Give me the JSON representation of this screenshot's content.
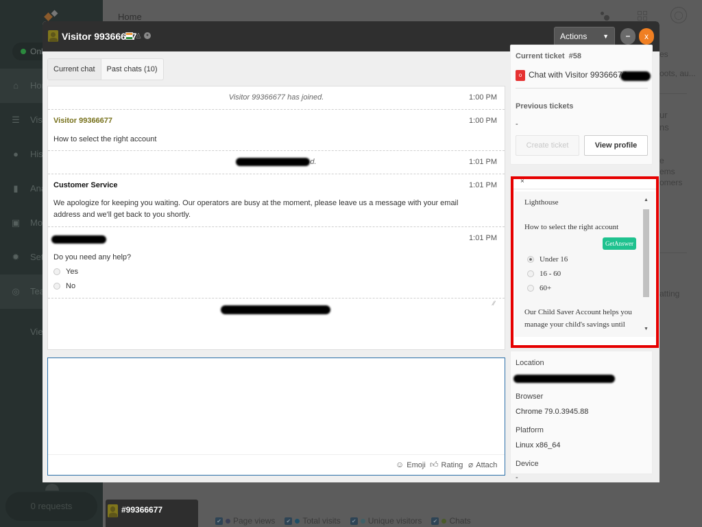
{
  "background": {
    "sidebar": {
      "status_label": "Online",
      "items": [
        {
          "label": "Home",
          "icon": "home-icon"
        },
        {
          "label": "Visitors",
          "icon": "visitors-icon"
        },
        {
          "label": "History",
          "icon": "clock-icon"
        },
        {
          "label": "Analytics",
          "icon": "bar-chart-icon"
        },
        {
          "label": "Monitor",
          "icon": "monitor-icon"
        },
        {
          "label": "Settings",
          "icon": "gear-icon"
        },
        {
          "label": "Teams",
          "icon": "teams-icon"
        }
      ],
      "view_label": "View",
      "requests_label": "0 requests"
    },
    "topbar": {
      "breadcrumb": "Home"
    },
    "right_text": [
      "es",
      "oots, au...",
      "ur",
      "ns",
      "e",
      "ems",
      "omers",
      "atting"
    ],
    "legend": [
      {
        "label": "Page views",
        "color": "#3a3f55"
      },
      {
        "label": "Total visits",
        "color": "#1f4f66"
      },
      {
        "label": "Unique visitors",
        "color": "#3f5f66"
      },
      {
        "label": "Chats",
        "color": "#4a5a2a"
      }
    ],
    "minichat_label": "#99366677"
  },
  "modal": {
    "title": "Visitor 99366677",
    "actions_label": "Actions",
    "minimize_label": "–",
    "close_label": "x",
    "tabs": [
      {
        "label": "Current chat",
        "active": true
      },
      {
        "label": "Past chats (10)",
        "active": false
      }
    ],
    "messages": [
      {
        "type": "system",
        "text": "Visitor 99366677 has joined.",
        "time": "1:00 PM"
      },
      {
        "type": "visitor",
        "author": "Visitor 99366677",
        "text": "How to select the right account",
        "time": "1:00 PM"
      },
      {
        "type": "system-redacted",
        "text_tail": "d.",
        "time": "1:01 PM"
      },
      {
        "type": "agent",
        "author": "Customer Service",
        "text": "We apologize for keeping you waiting. Our operators are busy at the moment, please leave us a message with your email address and we'll get back to you shortly.",
        "time": "1:01 PM"
      },
      {
        "type": "bot-redacted",
        "text": "Do you need any help?",
        "time": "1:01 PM",
        "options": [
          "Yes",
          "No"
        ]
      }
    ],
    "composer": {
      "placeholder": "",
      "emoji_label": "Emoji",
      "rating_label": "Rating",
      "attach_label": "Attach"
    },
    "ticket": {
      "current_label": "Current ticket",
      "current_number": "#58",
      "status_badge": "o",
      "ticket_title": "Chat with Visitor 99366677",
      "previous_label": "Previous tickets",
      "previous_value": "-",
      "create_label": "Create ticket",
      "view_profile_label": "View profile"
    },
    "lighthouse": {
      "close_label": "×",
      "title": "Lighthouse",
      "question": "How to select the right account",
      "get_answer_label": "GetAnswer",
      "options": [
        {
          "label": "Under 16",
          "selected": true
        },
        {
          "label": "16 - 60",
          "selected": false
        },
        {
          "label": "60+",
          "selected": false
        }
      ],
      "answer_line1": "Our Child Saver Account helps you",
      "answer_line2": "manage your child's savings until"
    },
    "visitor_info": {
      "location_label": "Location",
      "browser_label": "Browser",
      "browser_value": "Chrome 79.0.3945.88",
      "platform_label": "Platform",
      "platform_value": "Linux x86_64",
      "device_label": "Device",
      "device_value": "-"
    }
  }
}
